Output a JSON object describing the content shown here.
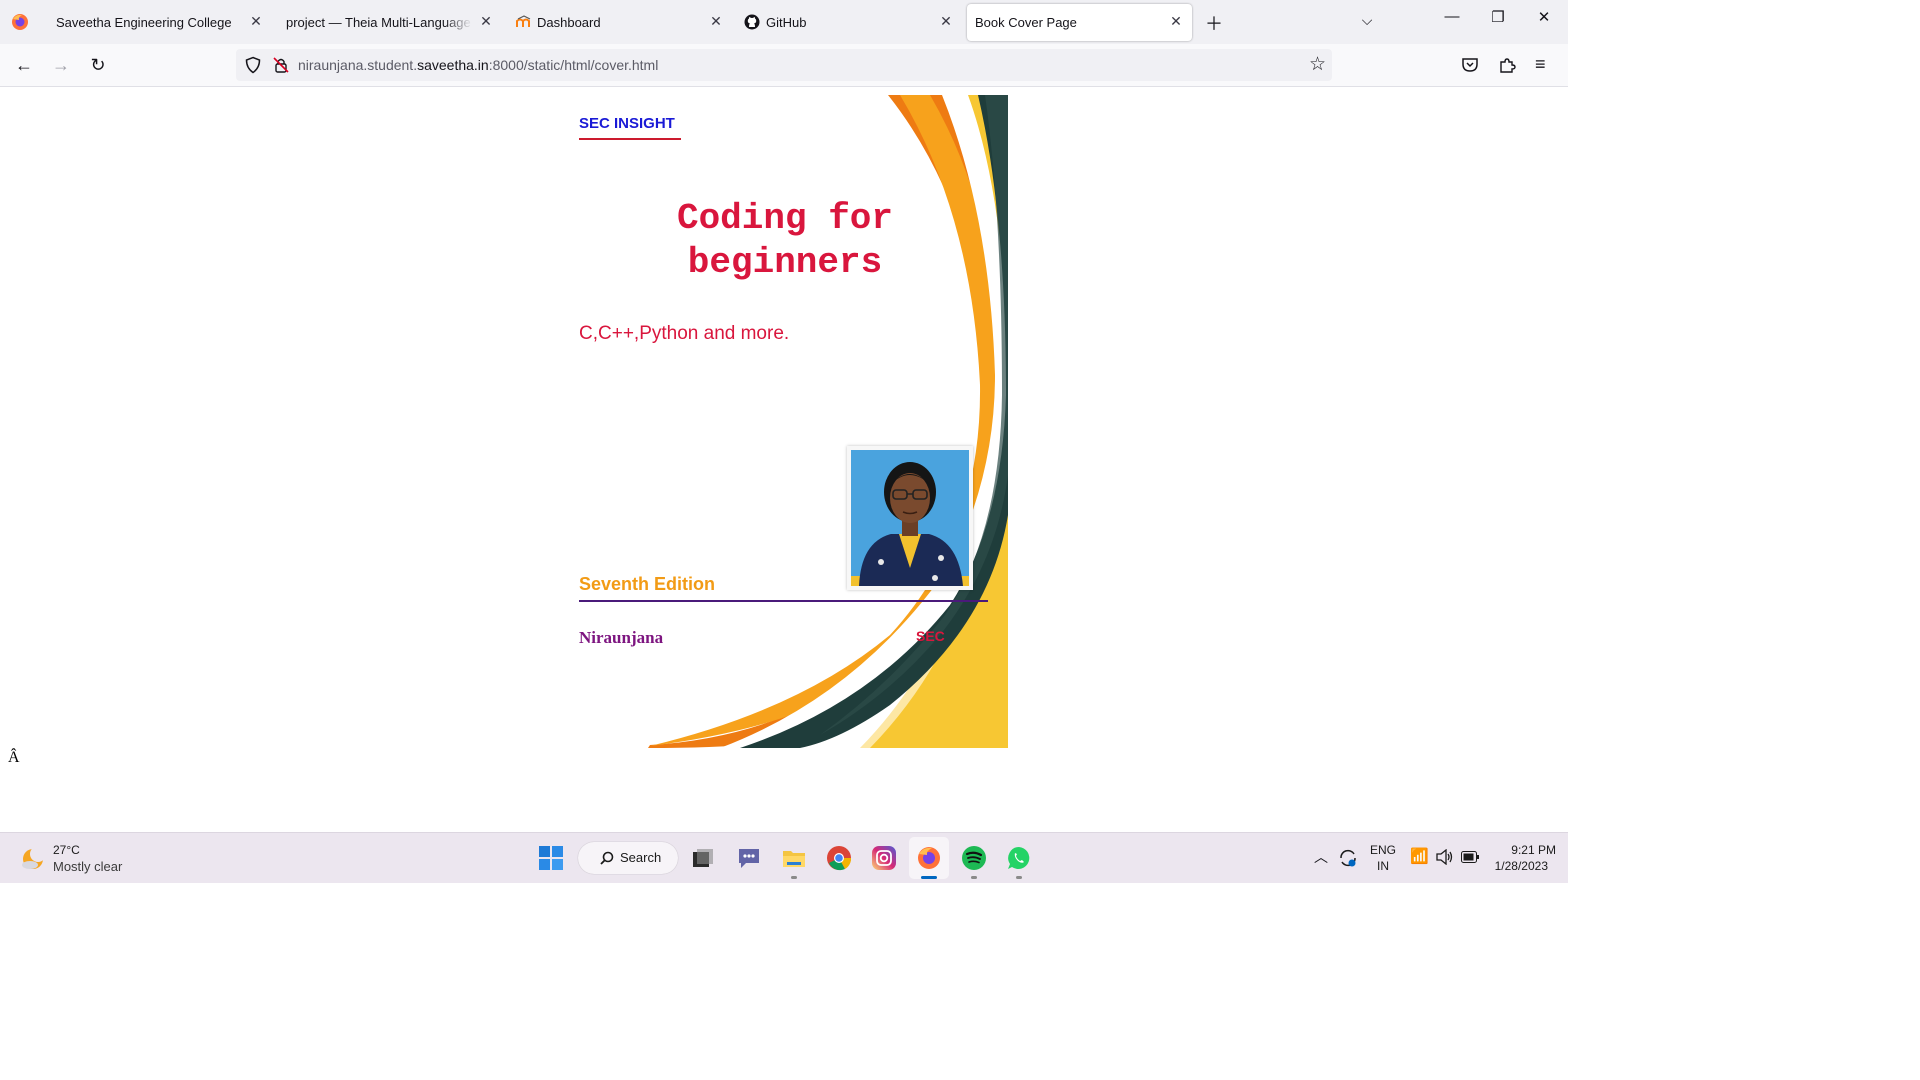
{
  "browser": {
    "tabs": [
      {
        "title": "Saveetha Engineering College",
        "active": false
      },
      {
        "title": "project — Theia Multi-Language Ex",
        "active": false
      },
      {
        "title": "Dashboard",
        "active": false
      },
      {
        "title": "GitHub",
        "active": false
      },
      {
        "title": "Book Cover Page",
        "active": true
      }
    ],
    "url_prefix": "niraunjana.student.",
    "url_domain": "saveetha.in",
    "url_suffix": ":8000/static/html/cover.html"
  },
  "cover": {
    "publisher_brand": "SEC INSIGHT",
    "title_line1": "Coding for",
    "title_line2": "beginners",
    "subtitle": "C,C++,Python and more.",
    "edition": "Seventh Edition",
    "author": "Niraunjana",
    "publisher": "SEC"
  },
  "page_stray_text": "Â",
  "taskbar": {
    "temperature": "27°C",
    "weather": "Mostly clear",
    "search_label": "Search",
    "language": "ENG",
    "region": "IN",
    "time": "9:21 PM",
    "date": "1/28/2023"
  },
  "colors": {
    "title_red": "#d9163d",
    "brand_blue": "#1a1ad6",
    "edition_orange": "#f29b16",
    "author_purple": "#7d1580"
  }
}
